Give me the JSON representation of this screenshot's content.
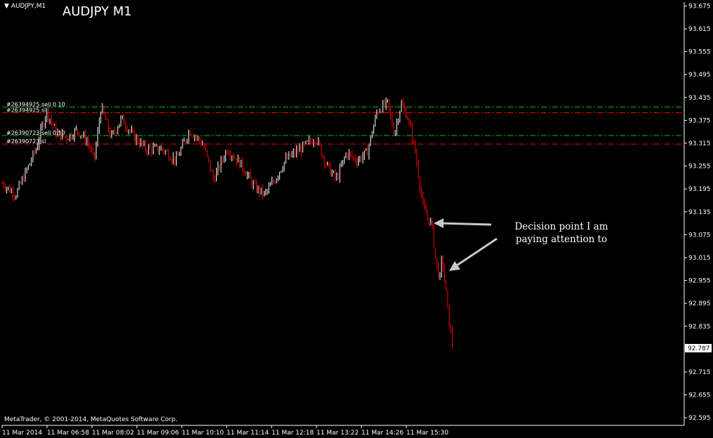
{
  "window": {
    "symbol_tag": "AUDJPY,M1",
    "title": "AUDJPY M1",
    "copyright": "MetaTrader, © 2001-2014, MetaQuotes Software Corp."
  },
  "annotation": {
    "text": "Decision point I am paying attention to"
  },
  "colors": {
    "background": "#000000",
    "axis": "#ffffff",
    "bull_candle": "#ffffff",
    "bear_candle": "#ff0000",
    "buy_level": "#00c000",
    "sell_level": "#ff0000"
  },
  "chart_data": {
    "type": "line",
    "title": "AUDJPY M1",
    "ylim": [
      92.575,
      93.685
    ],
    "y_ticks": [
      "93.675",
      "93.615",
      "93.555",
      "93.495",
      "93.435",
      "93.375",
      "93.315",
      "93.255",
      "93.195",
      "93.135",
      "93.075",
      "93.015",
      "92.955",
      "92.895",
      "92.835",
      "92.775",
      "92.715",
      "92.655",
      "92.595"
    ],
    "x_ticks": [
      "11 Mar 2014",
      "11 Mar 06:58",
      "11 Mar 08:02",
      "11 Mar 09:06",
      "11 Mar 10:10",
      "11 Mar 11:14",
      "11 Mar 12:18",
      "11 Mar 13:22",
      "11 Mar 14:26",
      "11 Mar 15:30"
    ],
    "current_price": "92.787",
    "trade_levels": [
      {
        "label": "#26394925 sell 0.10",
        "price": 93.41,
        "kind": "open"
      },
      {
        "label": "#26394925 sl",
        "price": 93.395,
        "kind": "stop"
      },
      {
        "label": "#26390723 sell 0.10",
        "price": 93.335,
        "kind": "open"
      },
      {
        "label": "#26390723 sl",
        "price": 93.313,
        "kind": "stop"
      }
    ],
    "series": [
      {
        "x": [
          "11 Mar 2014",
          "11 Mar 06:58",
          "11 Mar 08:02",
          "11 Mar 09:06",
          "11 Mar 10:10",
          "11 Mar 11:14",
          "11 Mar 12:18",
          "11 Mar 13:22",
          "11 Mar 14:26",
          "11 Mar 15:30"
        ],
        "values": [
          93.21,
          93.36,
          93.38,
          93.31,
          93.31,
          93.19,
          93.29,
          93.23,
          93.37,
          92.8
        ]
      }
    ],
    "price_path": [
      {
        "x": 0,
        "y": 93.21
      },
      {
        "x": 0.02,
        "y": 93.18
      },
      {
        "x": 0.05,
        "y": 93.3
      },
      {
        "x": 0.065,
        "y": 93.4
      },
      {
        "x": 0.08,
        "y": 93.34
      },
      {
        "x": 0.095,
        "y": 93.33
      },
      {
        "x": 0.11,
        "y": 93.35
      },
      {
        "x": 0.125,
        "y": 93.32
      },
      {
        "x": 0.135,
        "y": 93.27
      },
      {
        "x": 0.145,
        "y": 93.41
      },
      {
        "x": 0.16,
        "y": 93.33
      },
      {
        "x": 0.175,
        "y": 93.38
      },
      {
        "x": 0.19,
        "y": 93.34
      },
      {
        "x": 0.21,
        "y": 93.3
      },
      {
        "x": 0.235,
        "y": 93.3
      },
      {
        "x": 0.255,
        "y": 93.27
      },
      {
        "x": 0.275,
        "y": 93.35
      },
      {
        "x": 0.295,
        "y": 93.31
      },
      {
        "x": 0.31,
        "y": 93.22
      },
      {
        "x": 0.33,
        "y": 93.3
      },
      {
        "x": 0.35,
        "y": 93.26
      },
      {
        "x": 0.37,
        "y": 93.2
      },
      {
        "x": 0.385,
        "y": 93.18
      },
      {
        "x": 0.4,
        "y": 93.22
      },
      {
        "x": 0.415,
        "y": 93.27
      },
      {
        "x": 0.43,
        "y": 93.29
      },
      {
        "x": 0.445,
        "y": 93.31
      },
      {
        "x": 0.46,
        "y": 93.33
      },
      {
        "x": 0.475,
        "y": 93.26
      },
      {
        "x": 0.49,
        "y": 93.22
      },
      {
        "x": 0.505,
        "y": 93.29
      },
      {
        "x": 0.52,
        "y": 93.27
      },
      {
        "x": 0.535,
        "y": 93.29
      },
      {
        "x": 0.55,
        "y": 93.4
      },
      {
        "x": 0.565,
        "y": 93.42
      },
      {
        "x": 0.575,
        "y": 93.34
      },
      {
        "x": 0.585,
        "y": 93.42
      },
      {
        "x": 0.595,
        "y": 93.38
      },
      {
        "x": 0.605,
        "y": 93.3
      },
      {
        "x": 0.613,
        "y": 93.2
      },
      {
        "x": 0.618,
        "y": 93.14
      },
      {
        "x": 0.624,
        "y": 93.12
      },
      {
        "x": 0.63,
        "y": 93.1
      },
      {
        "x": 0.636,
        "y": 93.0
      },
      {
        "x": 0.642,
        "y": 92.96
      },
      {
        "x": 0.645,
        "y": 93.02
      },
      {
        "x": 0.655,
        "y": 92.85
      },
      {
        "x": 0.66,
        "y": 92.79
      }
    ]
  }
}
